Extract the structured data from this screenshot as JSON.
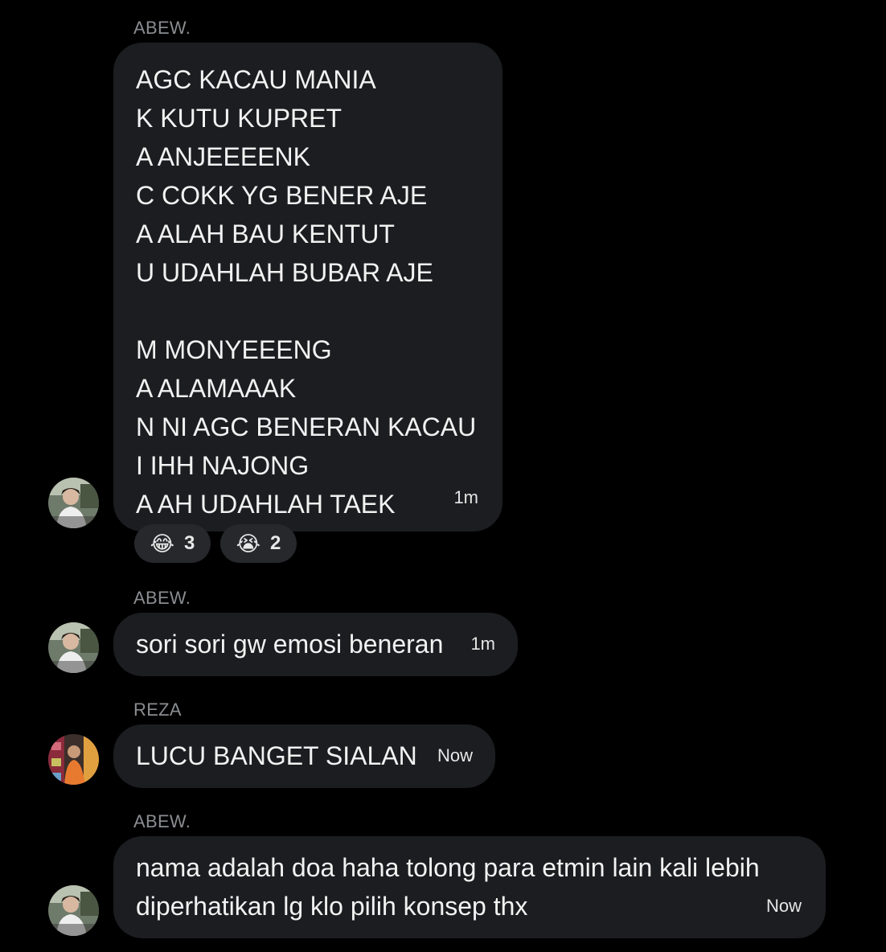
{
  "messages": [
    {
      "sender": "ABEW.",
      "text": "AGC KACAU MANIA\nK KUTU KUPRET\nA ANJEEEENK\nC COKK YG BENER AJE\nA ALAH BAU KENTUT\nU UDAHLAH BUBAR AJE\n\nM MONYEEENG\nA ALAMAAAK\nN NI AGC BENERAN KACAU\nI IHH NAJONG\nA AH UDAHLAH TAEK",
      "time": "1m",
      "reactions": [
        {
          "emoji": "😂",
          "count": "3"
        },
        {
          "emoji": "😭",
          "count": "2"
        }
      ]
    },
    {
      "sender": "ABEW.",
      "text": "sori sori gw emosi beneran",
      "time": "1m"
    },
    {
      "sender": "REZA",
      "text": "LUCU BANGET SIALAN",
      "time": "Now"
    },
    {
      "sender": "ABEW.",
      "text": "nama adalah doa haha tolong para etmin lain kali lebih\ndiperhatikan lg klo pilih konsep thx",
      "time": "Now"
    }
  ]
}
